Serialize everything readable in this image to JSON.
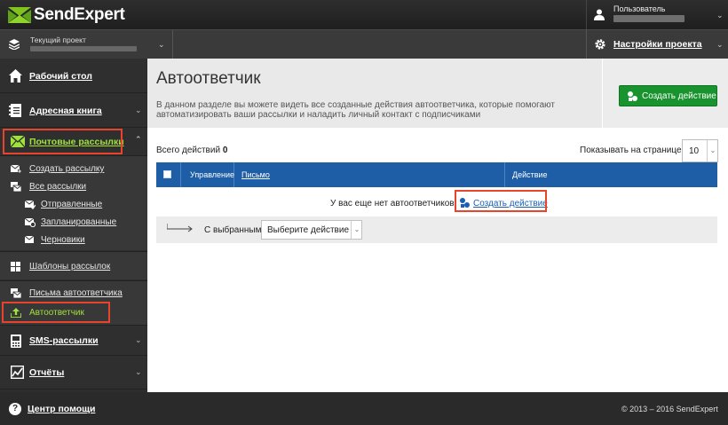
{
  "app": {
    "logo_text": "SendExpert"
  },
  "user": {
    "label": "Пользователь"
  },
  "project": {
    "label": "Текущий проект",
    "settings_label": "Настройки проекта"
  },
  "sidebar": {
    "dashboard": "Рабочий стол",
    "address_book": "Адресная книга",
    "mailings": "Почтовые рассылки",
    "mailings_items": {
      "create": "Создать рассылку",
      "all": "Все рассылки",
      "sent": "Отправленные",
      "scheduled": "Запланированные",
      "drafts": "Черновики",
      "templates": "Шаблоны рассылок",
      "autoresponder_letters": "Письма автоответчика",
      "autoresponder": "Автоответчик"
    },
    "sms": "SMS-рассылки",
    "reports": "Отчёты"
  },
  "main": {
    "title": "Автоответчик",
    "description": "В данном разделе вы можете видеть все созданные действия автоответчика, которые помогают автоматизировать ваши рассылки и наладить личный контакт с подписчиками",
    "create_button": "Создать действие",
    "total_label": "Всего действий",
    "total_count": "0",
    "per_page_label": "Показывать на странице:",
    "per_page_value": "10",
    "table": {
      "columns": [
        "Управление",
        "Письмо",
        "Действие"
      ],
      "empty_text": "У вас еще нет автоответчиков.",
      "empty_link": "Создать действие"
    },
    "bulk": {
      "label": "С выбранными:",
      "placeholder": "Выберите действие"
    }
  },
  "footer": {
    "help": "Центр помощи",
    "copyright": "© 2013 – 2016 SendExpert"
  },
  "colors": {
    "accent_green": "#18932e",
    "nav_active": "#9ee23a",
    "table_header": "#1d5ea7",
    "highlight": "#e8442b",
    "link": "#1a5fb4"
  }
}
